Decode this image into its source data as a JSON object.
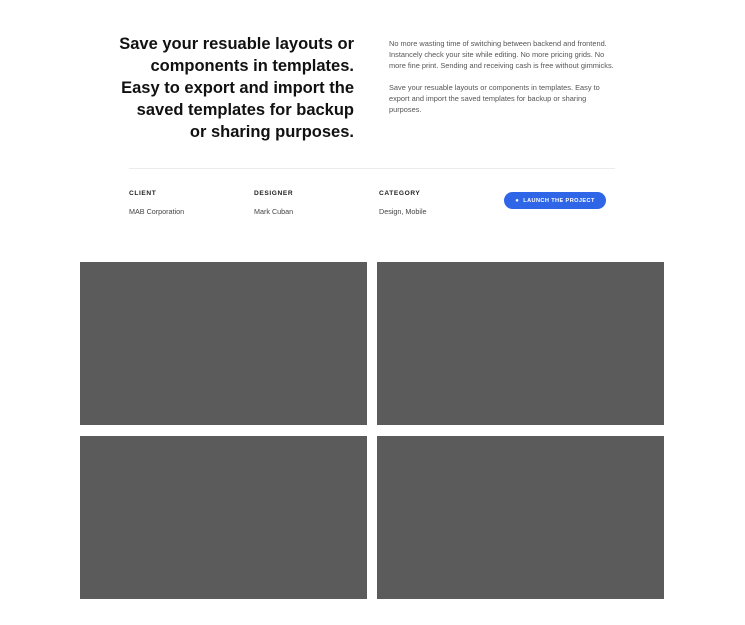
{
  "intro": {
    "headline": "Save your resuable layouts or components in templates. Easy to export and import the saved templates for backup or sharing purposes.",
    "paragraph_1": "No more wasting time of switching between backend and frontend. Instancely check your site while editing. No more pricing grids. No more fine print. Sending and receiving cash is free without gimmicks.",
    "paragraph_2": "Save your resuable layouts or components in templates. Easy to export and import the saved templates for backup or sharing purposes."
  },
  "meta": {
    "client_label": "CLIENT",
    "client_value": "MAB Corporation",
    "designer_label": "DESIGNER",
    "designer_value": "Mark Cuban",
    "category_label": "CATEGORY",
    "category_value": "Design, Mobile"
  },
  "launch_button": {
    "label": "LAUNCH THE PROJECT",
    "icon": "apple-icon",
    "color": "#2f66e8"
  },
  "gallery": {
    "placeholder_color": "#5b5b5b",
    "count": 4
  }
}
